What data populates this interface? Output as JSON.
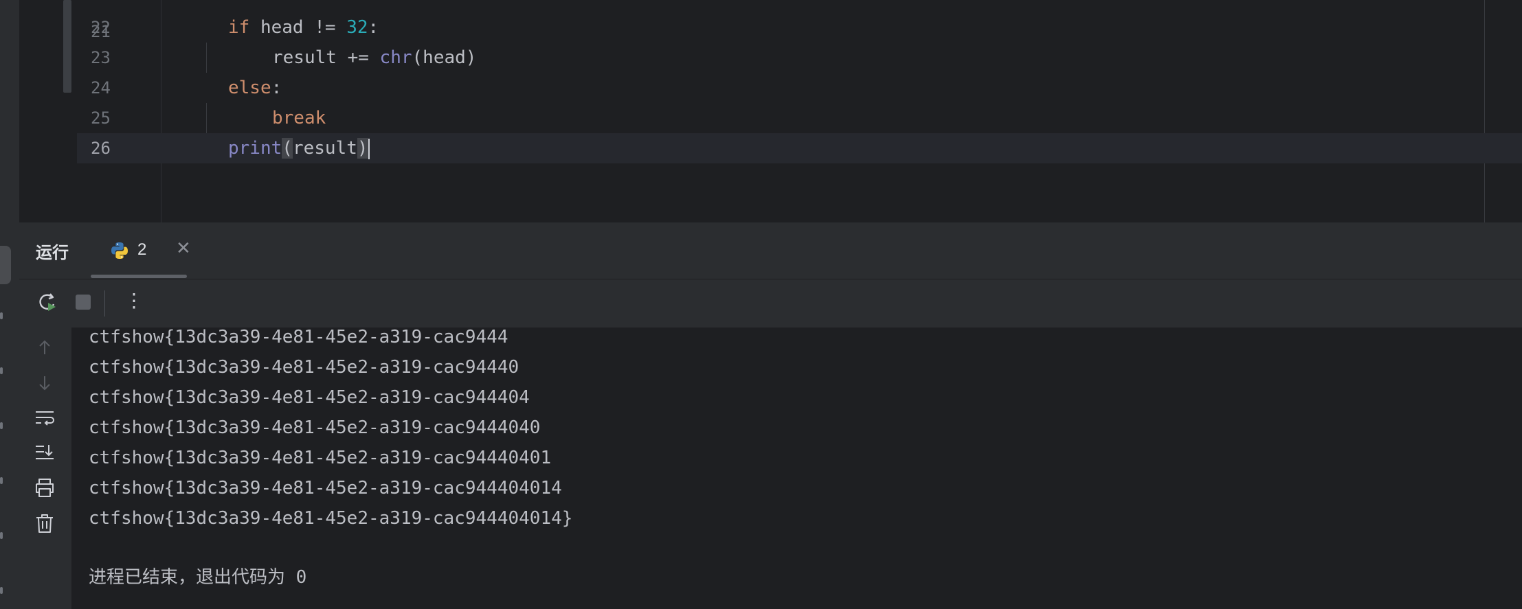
{
  "editor": {
    "partial_line_number": "21",
    "lines": [
      {
        "number": "22",
        "tokens": [
          {
            "t": "if",
            "c": "kw"
          },
          {
            "t": " head != ",
            "c": ""
          },
          {
            "t": "32",
            "c": "num"
          },
          {
            "t": ":",
            "c": ""
          }
        ]
      },
      {
        "number": "23",
        "tokens": [
          {
            "t": "result += ",
            "c": ""
          },
          {
            "t": "chr",
            "c": "bi"
          },
          {
            "t": "(head)",
            "c": ""
          }
        ]
      },
      {
        "number": "24",
        "tokens": [
          {
            "t": "else",
            "c": "kw"
          },
          {
            "t": ":",
            "c": ""
          }
        ]
      },
      {
        "number": "25",
        "tokens": [
          {
            "t": "break",
            "c": "kw"
          }
        ]
      },
      {
        "number": "26",
        "tokens": [
          {
            "t": "print",
            "c": "bi"
          },
          {
            "t": "(",
            "c": "brace"
          },
          {
            "t": "result",
            "c": ""
          },
          {
            "t": ")",
            "c": "brace"
          }
        ]
      }
    ],
    "current_line": "26"
  },
  "run_panel": {
    "title": "运行",
    "tab_label": "2",
    "toolbar": {
      "rerun_icon": "rerun-icon",
      "stop_icon": "stop-icon",
      "more_icon": "more-vertical-icon"
    },
    "side_icons": [
      "arrow-up-icon",
      "arrow-down-icon",
      "soft-wrap-icon",
      "scroll-to-end-icon",
      "print-icon",
      "trash-icon"
    ]
  },
  "console": {
    "output_lines": [
      "ctfshow{13dc3a39-4e81-45e2-a319-cac9444",
      "ctfshow{13dc3a39-4e81-45e2-a319-cac94440",
      "ctfshow{13dc3a39-4e81-45e2-a319-cac944404",
      "ctfshow{13dc3a39-4e81-45e2-a319-cac9444040",
      "ctfshow{13dc3a39-4e81-45e2-a319-cac94440401",
      "ctfshow{13dc3a39-4e81-45e2-a319-cac944404014",
      "ctfshow{13dc3a39-4e81-45e2-a319-cac944404014}"
    ],
    "exit_message": "进程已结束，退出代码为 0"
  },
  "colors": {
    "keyword": "#cf8e6d",
    "number": "#2aacb8",
    "builtin": "#8888c6",
    "text": "#bcbec4",
    "background": "#1e1f22",
    "panel": "#2b2d30"
  }
}
